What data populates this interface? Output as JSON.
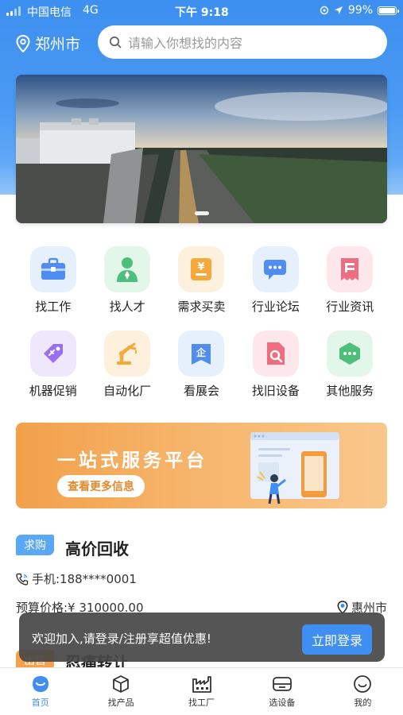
{
  "status_bar": {
    "carrier": "中国电信",
    "network": "4G",
    "time": "下午 9:18",
    "battery": "99%",
    "battery_level": 0.99
  },
  "header": {
    "city": "郑州市",
    "search_placeholder": "请输入你想找的内容"
  },
  "banner": {
    "pages": 1
  },
  "quick_actions": [
    {
      "label": "找工作",
      "icon": "briefcase-icon",
      "color": "#4f8ef0",
      "bg": "#e6f0fd"
    },
    {
      "label": "找人才",
      "icon": "person-icon",
      "color": "#4cbf7a",
      "bg": "#e2f6ea"
    },
    {
      "label": "需求买卖",
      "icon": "yen-tag-icon",
      "color": "#f5a93b",
      "bg": "#fdf1de"
    },
    {
      "label": "行业论坛",
      "icon": "chat-bubbles-icon",
      "color": "#4f8ef0",
      "bg": "#e6f0fd"
    },
    {
      "label": "行业资讯",
      "icon": "news-receipt-icon",
      "color": "#ee6d7e",
      "bg": "#fde7ea"
    },
    {
      "label": "机器促销",
      "icon": "price-tag-icon",
      "color": "#9a6ff0",
      "bg": "#efe8fd"
    },
    {
      "label": "自动化厂",
      "icon": "robot-arm-icon",
      "color": "#f5a93b",
      "bg": "#fdf1de"
    },
    {
      "label": "看展会",
      "icon": "exhibition-icon",
      "color": "#4f8ef0",
      "bg": "#e6f0fd"
    },
    {
      "label": "找旧设备",
      "icon": "search-document-icon",
      "color": "#ee6d7e",
      "bg": "#fde7ea"
    },
    {
      "label": "其他服务",
      "icon": "more-hexagon-icon",
      "color": "#4cbf7a",
      "bg": "#e2f6ea"
    }
  ],
  "promo": {
    "title": "一站式服务平台",
    "button": "查看更多信息"
  },
  "listing_1": {
    "tag": "求购",
    "title": "高价回收",
    "phone": "手机:188****0001",
    "budget": "预算价格:¥ 310000.00",
    "city": "惠州市"
  },
  "listing_2": {
    "tag": "出售",
    "title": "忍痛转让"
  },
  "toast": {
    "text": "欢迎加入,请登录/注册享超值优惠!",
    "button": "立即登录"
  },
  "tabbar": [
    {
      "label": "首页",
      "icon": "home-icon",
      "active": true
    },
    {
      "label": "找产品",
      "icon": "box-icon",
      "active": false
    },
    {
      "label": "找工厂",
      "icon": "factory-icon",
      "active": false
    },
    {
      "label": "选设备",
      "icon": "device-icon",
      "active": false
    },
    {
      "label": "我的",
      "icon": "smile-icon",
      "active": false
    }
  ],
  "colors": {
    "primary": "#3f8ef2",
    "accent_orange": "#f3a24b"
  }
}
